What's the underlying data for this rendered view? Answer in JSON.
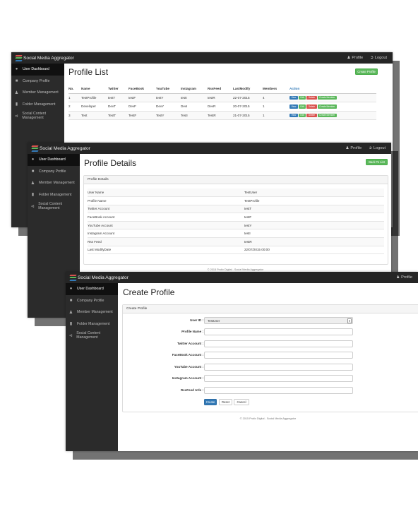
{
  "app": {
    "brand": "Social Media Aggregator",
    "profile_label": "Profile",
    "logout_label": "Logout",
    "footer": "© 2015 Protiv Digital - Social Media Aggregator"
  },
  "sidebar": {
    "items": [
      {
        "label": "User Dashboard",
        "icon": "dashboard-icon"
      },
      {
        "label": "Company Profile",
        "icon": "building-icon"
      },
      {
        "label": "Member Management",
        "icon": "user-icon"
      },
      {
        "label": "Folder Management",
        "icon": "folder-icon"
      },
      {
        "label": "Social Content Management",
        "icon": "share-icon"
      }
    ]
  },
  "profile_list": {
    "title": "Profile List",
    "create_button": "Create Profile",
    "columns": [
      "No.",
      "Name",
      "Twitter",
      "FaceBook",
      "YouTube",
      "Instagram",
      "RssFeed",
      "LastModify",
      "Members",
      "Action"
    ],
    "rows": [
      [
        "1",
        "TestProfile",
        "testT",
        "testF",
        "testY",
        "testI",
        "testR",
        "22-07-2015",
        "4"
      ],
      [
        "2",
        "Developer",
        "DevT",
        "DevF",
        "DevY",
        "DevI",
        "DevR",
        "20-07-2015",
        "1"
      ],
      [
        "3",
        "Test",
        "TestT",
        "TestF",
        "TestY",
        "TestI",
        "TestR",
        "21-07-2015",
        "1"
      ]
    ],
    "actions": [
      "View",
      "Edit",
      "Delete",
      "Create Member"
    ]
  },
  "profile_details": {
    "title": "Profile Details",
    "back_button": "Back To List",
    "panel_title": "Profile Details",
    "fields": [
      [
        "User Name",
        "TestUser"
      ],
      [
        "Profile Name",
        "TestProfile"
      ],
      [
        "Twitter Account",
        "testT"
      ],
      [
        "FaceBook Account",
        "testF"
      ],
      [
        "YouTube Account",
        "testY"
      ],
      [
        "Instagram Account",
        "testI"
      ],
      [
        "Rss Feed",
        "testR"
      ],
      [
        "Last ModifyDate",
        "22/07/2015 00:00"
      ]
    ]
  },
  "create_profile": {
    "title": "Create Profile",
    "panel_title": "Create Profile",
    "user_id_label": "User ID :",
    "user_id_value": "TestUser",
    "fields": [
      "Profile Name :",
      "Twitter Account :",
      "FaceBook Account :",
      "YouTube Account :",
      "Instagram Account :",
      "RssFeed Urls :"
    ],
    "buttons": {
      "create": "Create",
      "reset": "Reset",
      "cancel": "Cancel"
    }
  },
  "colors": {
    "topbar": "#252525",
    "sidebar": "#2b2b2b",
    "green": "#5cb85c",
    "blue": "#337ab7",
    "red": "#d9534f"
  }
}
